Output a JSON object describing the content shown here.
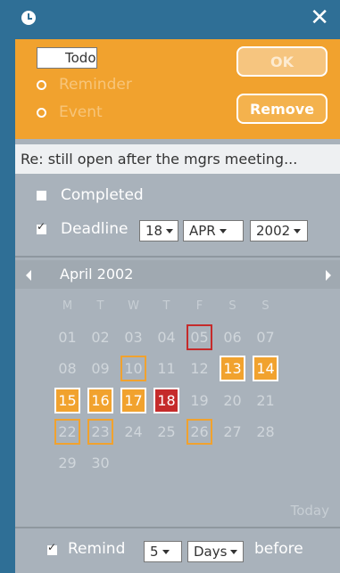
{
  "window": {
    "close_glyph": "✕"
  },
  "type_options": [
    {
      "label": "Todo",
      "selected": true
    },
    {
      "label": "Reminder",
      "selected": false
    },
    {
      "label": "Event",
      "selected": false
    }
  ],
  "buttons": {
    "ok": "OK",
    "remove": "Remove"
  },
  "subject": "Re: still open after the mgrs meeting...",
  "completed": {
    "label": "Completed",
    "checked": false
  },
  "deadline": {
    "label": "Deadline",
    "checked": true,
    "day": "18",
    "month": "APR",
    "year": "2002"
  },
  "calendar": {
    "month_label": "April 2002",
    "weekdays": [
      "M",
      "T",
      "W",
      "T",
      "F",
      "S",
      "S"
    ],
    "weeks": [
      [
        "01",
        "02",
        "03",
        "04",
        "05",
        "06",
        "07"
      ],
      [
        "08",
        "09",
        "10",
        "11",
        "12",
        "13",
        "14"
      ],
      [
        "15",
        "16",
        "17",
        "18",
        "19",
        "20",
        "21"
      ],
      [
        "22",
        "23",
        "24",
        "25",
        "26",
        "27",
        "28"
      ],
      [
        "29",
        "30",
        "",
        "",
        "",
        "",
        ""
      ]
    ],
    "filled_orange": [
      "13",
      "14",
      "15",
      "16",
      "17"
    ],
    "filled_red": [
      "18"
    ],
    "outlined_orange": [
      "10",
      "22",
      "23",
      "26"
    ],
    "outlined_red": [
      "05"
    ],
    "today_label": "Today"
  },
  "remind": {
    "label": "Remind",
    "checked": true,
    "amount": "5",
    "unit": "Days",
    "suffix": "before"
  }
}
